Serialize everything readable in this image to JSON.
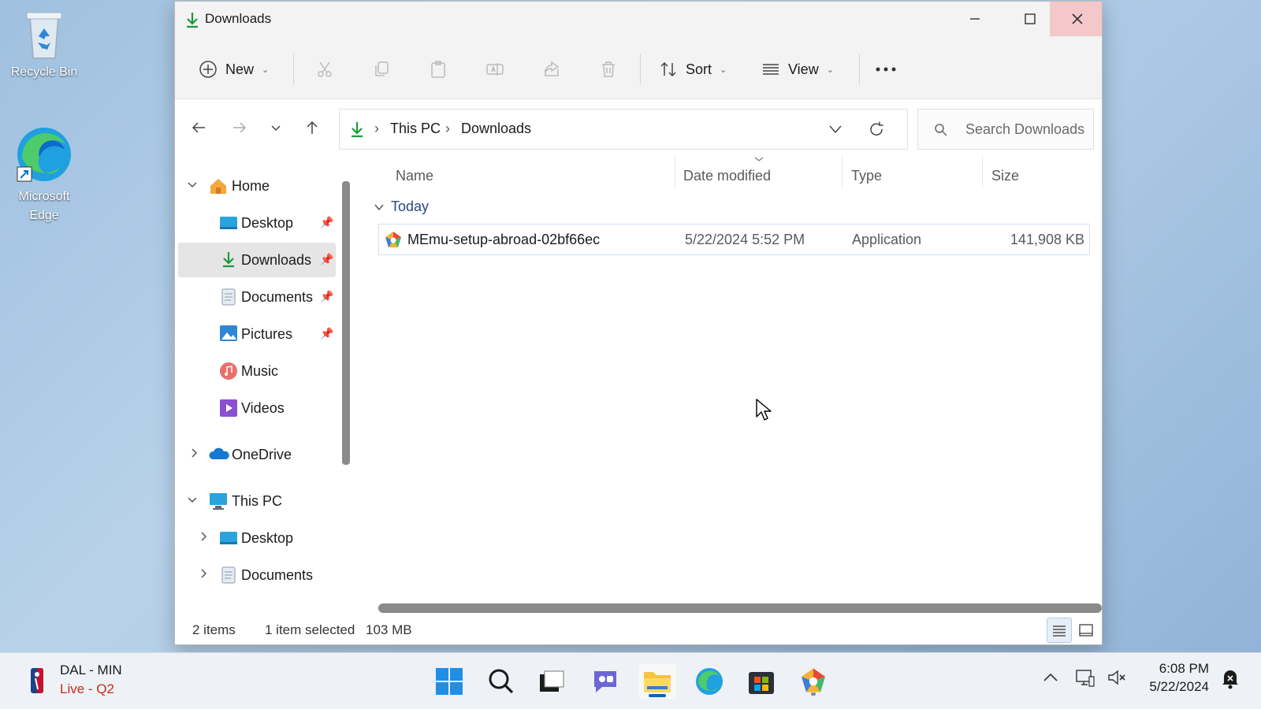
{
  "desktop": {
    "icons": [
      {
        "label": "Recycle Bin",
        "icon": "recycle-bin-icon"
      },
      {
        "label": "Microsoft\nEdge",
        "icon": "edge-icon"
      }
    ]
  },
  "window": {
    "title": "Downloads",
    "controls": {
      "minimize": "minimize-icon",
      "maximize": "maximize-icon",
      "close": "close-icon"
    }
  },
  "toolbar": {
    "new_label": "New",
    "sort_label": "Sort",
    "view_label": "View",
    "more": "more-icon",
    "icons": [
      "cut-icon",
      "copy-icon",
      "paste-icon",
      "rename-icon",
      "share-icon",
      "delete-icon"
    ]
  },
  "navigation": {
    "breadcrumb": [
      "This PC",
      "Downloads"
    ],
    "search_placeholder": "Search Downloads"
  },
  "sidebar": {
    "items": [
      {
        "label": "Home",
        "icon": "home-icon",
        "expander": "expanded"
      },
      {
        "label": "Desktop",
        "icon": "desktop-folder-icon",
        "pinned": true
      },
      {
        "label": "Downloads",
        "icon": "download-icon",
        "pinned": true,
        "selected": true
      },
      {
        "label": "Documents",
        "icon": "documents-icon",
        "pinned": true
      },
      {
        "label": "Pictures",
        "icon": "pictures-icon",
        "pinned": true
      },
      {
        "label": "Music",
        "icon": "music-icon"
      },
      {
        "label": "Videos",
        "icon": "videos-icon"
      },
      {
        "label": "OneDrive",
        "icon": "onedrive-icon",
        "expander": "collapsed"
      },
      {
        "label": "This PC",
        "icon": "this-pc-icon",
        "expander": "expanded"
      },
      {
        "label": "Desktop",
        "icon": "desktop-folder-icon",
        "expander": "collapsed"
      },
      {
        "label": "Documents",
        "icon": "documents-icon",
        "expander": "collapsed"
      }
    ]
  },
  "file_list": {
    "columns": [
      "Name",
      "Date modified",
      "Type",
      "Size"
    ],
    "group": "Today",
    "rows": [
      {
        "name": "MEmu-setup-abroad-02bf66ec",
        "date": "5/22/2024 5:52 PM",
        "type": "Application",
        "size": "141,908 KB",
        "selected": true
      }
    ]
  },
  "status": {
    "items": "2 items",
    "selected": "1 item selected",
    "size": "103 MB"
  },
  "taskbar": {
    "widget": {
      "title": "DAL - MIN",
      "subtitle": "Live - Q2"
    },
    "apps": [
      "start-icon",
      "search-icon",
      "task-view-icon",
      "chat-icon",
      "file-explorer-icon",
      "edge-icon",
      "store-icon",
      "memu-icon"
    ],
    "clock": {
      "time": "6:08 PM",
      "date": "5/22/2024"
    }
  },
  "colors": {
    "accent": "#0067c0",
    "download_green": "#1a9b3a",
    "close_hover": "#f4c8c8"
  }
}
